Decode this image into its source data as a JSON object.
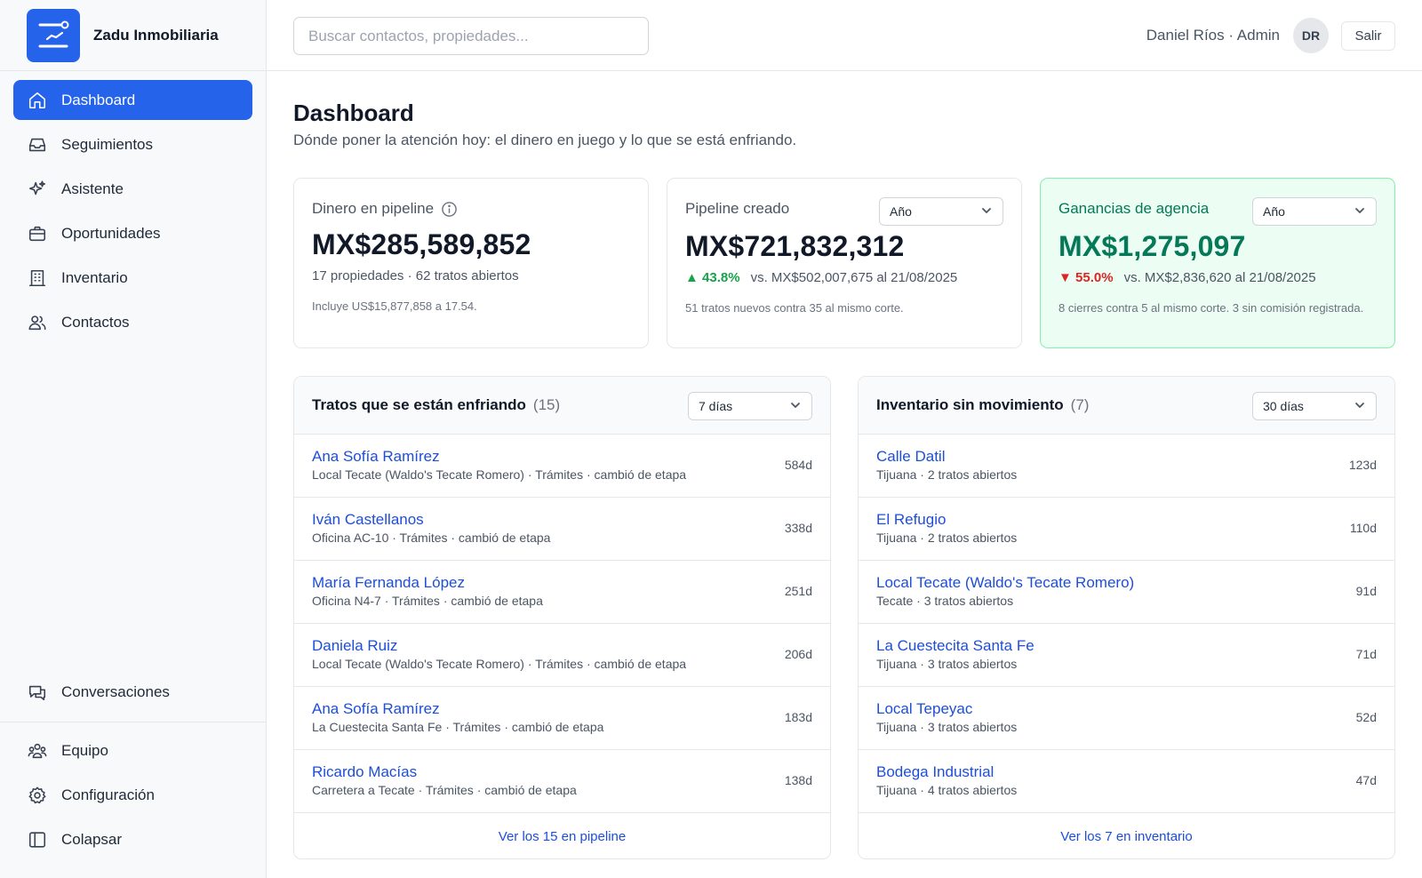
{
  "brand": {
    "name": "Zadu Inmobiliaria",
    "logo_color": "#2563eb"
  },
  "sidebar": {
    "items": [
      {
        "label": "Dashboard",
        "icon": "home-icon",
        "active": true
      },
      {
        "label": "Seguimientos",
        "icon": "inbox-icon"
      },
      {
        "label": "Asistente",
        "icon": "sparkles-icon"
      },
      {
        "label": "Oportunidades",
        "icon": "briefcase-icon"
      },
      {
        "label": "Inventario",
        "icon": "building-icon"
      },
      {
        "label": "Contactos",
        "icon": "users-icon"
      }
    ],
    "conversations": {
      "label": "Conversaciones",
      "icon": "chat-icon"
    },
    "bottom": [
      {
        "label": "Equipo",
        "icon": "team-icon"
      },
      {
        "label": "Configuración",
        "icon": "gear-icon"
      },
      {
        "label": "Colapsar",
        "icon": "sidebar-collapse-icon"
      }
    ]
  },
  "header": {
    "search_placeholder": "Buscar contactos, propiedades...",
    "user_name": "Daniel Ríos · Admin",
    "avatar_initials": "DR",
    "logout_label": "Salir"
  },
  "page": {
    "title": "Dashboard",
    "subtitle": "Dónde poner la atención hoy: el dinero en juego y lo que se está enfriando."
  },
  "cards": {
    "pipeline_money": {
      "label": "Dinero en pipeline",
      "value": "MX$285,589,852",
      "line1": "17 propiedades · 62 tratos abiertos",
      "line2": "Incluye US$15,877,858 a 17.54."
    },
    "pipeline_created": {
      "label": "Pipeline creado",
      "period": "Año",
      "value": "MX$721,832,312",
      "trend_arrow": "▲",
      "trend_pct": "43.8%",
      "trend_vs": "vs. MX$502,007,675 al 21/08/2025",
      "note": "51 tratos nuevos contra 35 al mismo corte."
    },
    "agency_earnings": {
      "label": "Ganancias de agencia",
      "period": "Año",
      "value": "MX$1,275,097",
      "trend_arrow": "▼",
      "trend_pct": "55.0%",
      "trend_vs": "vs. MX$2,836,620 al 21/08/2025",
      "note": "8 cierres contra 5 al mismo corte. 3 sin comisión registrada."
    }
  },
  "cooling": {
    "title": "Tratos que se están enfriando",
    "count": "(15)",
    "period": "7 días",
    "rows": [
      {
        "name": "Ana Sofía Ramírez",
        "detail": "Local Tecate (Waldo's Tecate Romero) · Trámites · cambió de etapa",
        "age": "584d"
      },
      {
        "name": "Iván Castellanos",
        "detail": "Oficina AC-10 · Trámites · cambió de etapa",
        "age": "338d"
      },
      {
        "name": "María Fernanda López",
        "detail": "Oficina N4-7 · Trámites · cambió de etapa",
        "age": "251d"
      },
      {
        "name": "Daniela Ruiz",
        "detail": "Local Tecate (Waldo's Tecate Romero) · Trámites · cambió de etapa",
        "age": "206d"
      },
      {
        "name": "Ana Sofía Ramírez",
        "detail": "La Cuestecita Santa Fe · Trámites · cambió de etapa",
        "age": "183d"
      },
      {
        "name": "Ricardo Macías",
        "detail": "Carretera a Tecate · Trámites · cambió de etapa",
        "age": "138d"
      }
    ],
    "footer": "Ver los 15 en pipeline"
  },
  "stale_inventory": {
    "title": "Inventario sin movimiento",
    "count": "(7)",
    "period": "30 días",
    "rows": [
      {
        "name": "Calle Datil",
        "detail": "Tijuana · 2 tratos abiertos",
        "age": "123d"
      },
      {
        "name": "El Refugio",
        "detail": "Tijuana · 2 tratos abiertos",
        "age": "110d"
      },
      {
        "name": "Local Tecate (Waldo's Tecate Romero)",
        "detail": "Tecate · 3 tratos abiertos",
        "age": "91d"
      },
      {
        "name": "La Cuestecita Santa Fe",
        "detail": "Tijuana · 3 tratos abiertos",
        "age": "71d"
      },
      {
        "name": "Local Tepeyac",
        "detail": "Tijuana · 3 tratos abiertos",
        "age": "52d"
      },
      {
        "name": "Bodega Industrial",
        "detail": "Tijuana · 4 tratos abiertos",
        "age": "47d"
      }
    ],
    "footer": "Ver los 7 en inventario"
  },
  "colors": {
    "accent": "#2563eb",
    "link": "#1d4ed8",
    "positive": "#16a34a",
    "negative": "#dc2626",
    "earnings_bg": "#ecfdf3",
    "earnings_text": "#047857"
  }
}
